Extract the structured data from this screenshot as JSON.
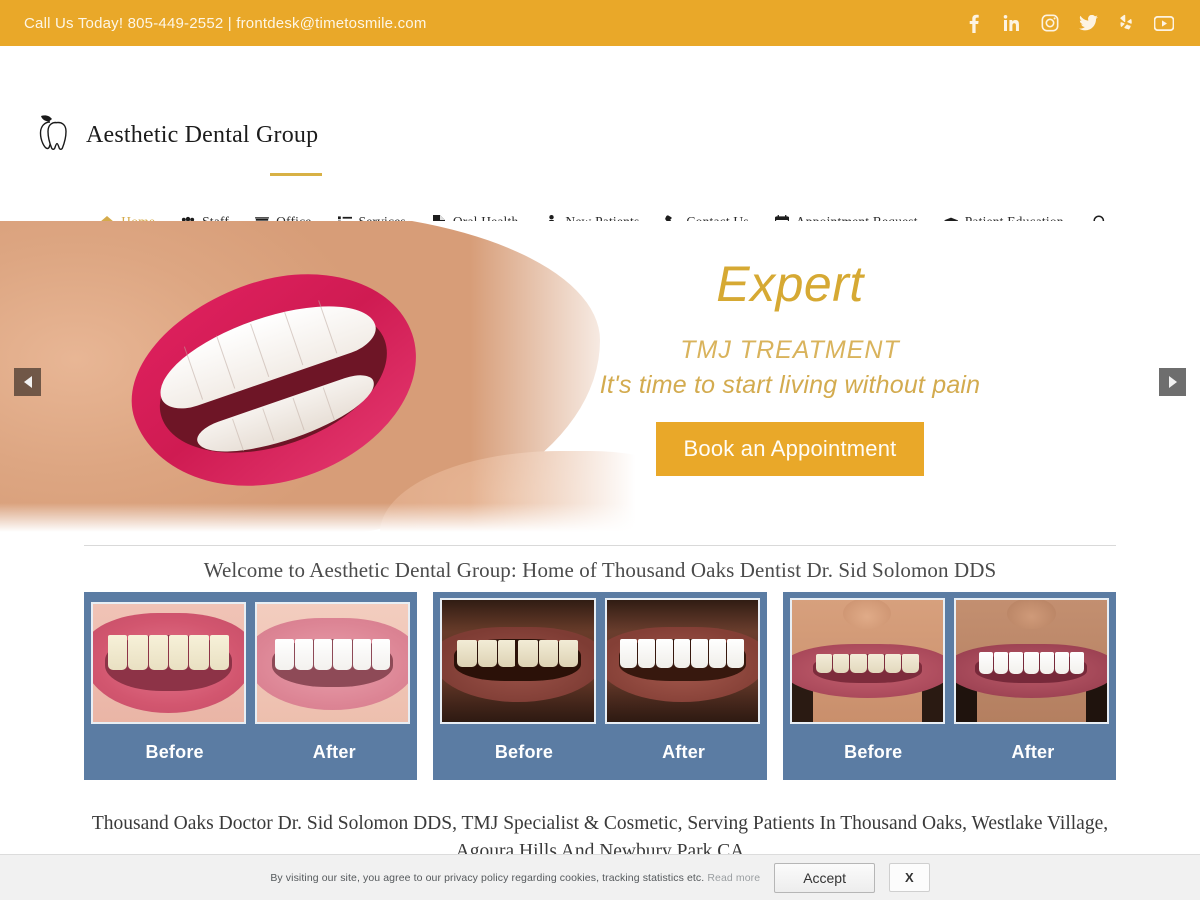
{
  "topbar": {
    "contact_text": "Call Us Today! 805-449-2552 | frontdesk@timetosmile.com",
    "phone": "805-449-2552",
    "email": "frontdesk@timetosmile.com",
    "background_color": "#e9a829",
    "socials": [
      {
        "name": "facebook-icon",
        "label": "Facebook"
      },
      {
        "name": "linkedin-icon",
        "label": "LinkedIn"
      },
      {
        "name": "instagram-icon",
        "label": "Instagram"
      },
      {
        "name": "twitter-icon",
        "label": "Twitter"
      },
      {
        "name": "yelp-icon",
        "label": "Yelp"
      },
      {
        "name": "youtube-icon",
        "label": "YouTube"
      }
    ]
  },
  "header": {
    "logo_text": "Aesthetic Dental Group",
    "logo_icon": "tooth-apple-logo"
  },
  "nav": {
    "items": [
      {
        "label": "Home",
        "icon": "home-icon",
        "active": true
      },
      {
        "label": "Staff",
        "icon": "users-icon",
        "active": false
      },
      {
        "label": "Office",
        "icon": "teeth-icon",
        "active": false
      },
      {
        "label": "Services",
        "icon": "list-icon",
        "active": false
      },
      {
        "label": "Oral Health",
        "icon": "file-icon",
        "active": false
      },
      {
        "label": "New Patients",
        "icon": "person-icon",
        "active": false
      },
      {
        "label": "Contact Us",
        "icon": "phone-icon",
        "active": false
      },
      {
        "label": "Appointment Request",
        "icon": "calendar-icon",
        "active": false
      },
      {
        "label": "Patient Education",
        "icon": "graduation-cap-icon",
        "active": false
      }
    ],
    "search_icon": "search-icon",
    "active_color": "#d5ab4b"
  },
  "hero": {
    "title": "Expert",
    "subtitle": "TMJ TREATMENT",
    "tagline": "It's time to start living without pain",
    "cta_label": "Book an Appointment",
    "prev_arrow": "prev-slide-arrow",
    "next_arrow": "next-slide-arrow",
    "accent_color": "#d6a933"
  },
  "welcome": {
    "heading": "Welcome to Aesthetic Dental Group: Home of Thousand Oaks Dentist Dr. Sid Solomon DDS"
  },
  "gallery": {
    "card_background": "#5b7ca3",
    "cards": [
      {
        "before_label": "Before",
        "after_label": "After"
      },
      {
        "before_label": "Before",
        "after_label": "After"
      },
      {
        "before_label": "Before",
        "after_label": "After"
      }
    ]
  },
  "tagline": {
    "line1": "Thousand Oaks Doctor Dr. Sid Solomon DDS, TMJ Specialist & Cosmetic, Serving Patients In Thousand Oaks, Westlake Village,",
    "line2": "Agoura Hills And Newbury Park CA"
  },
  "cookie": {
    "message": "By visiting our site, you agree to our privacy policy regarding cookies, tracking statistics etc.",
    "read_more": "Read more",
    "accept_label": "Accept",
    "close_label": "X"
  }
}
